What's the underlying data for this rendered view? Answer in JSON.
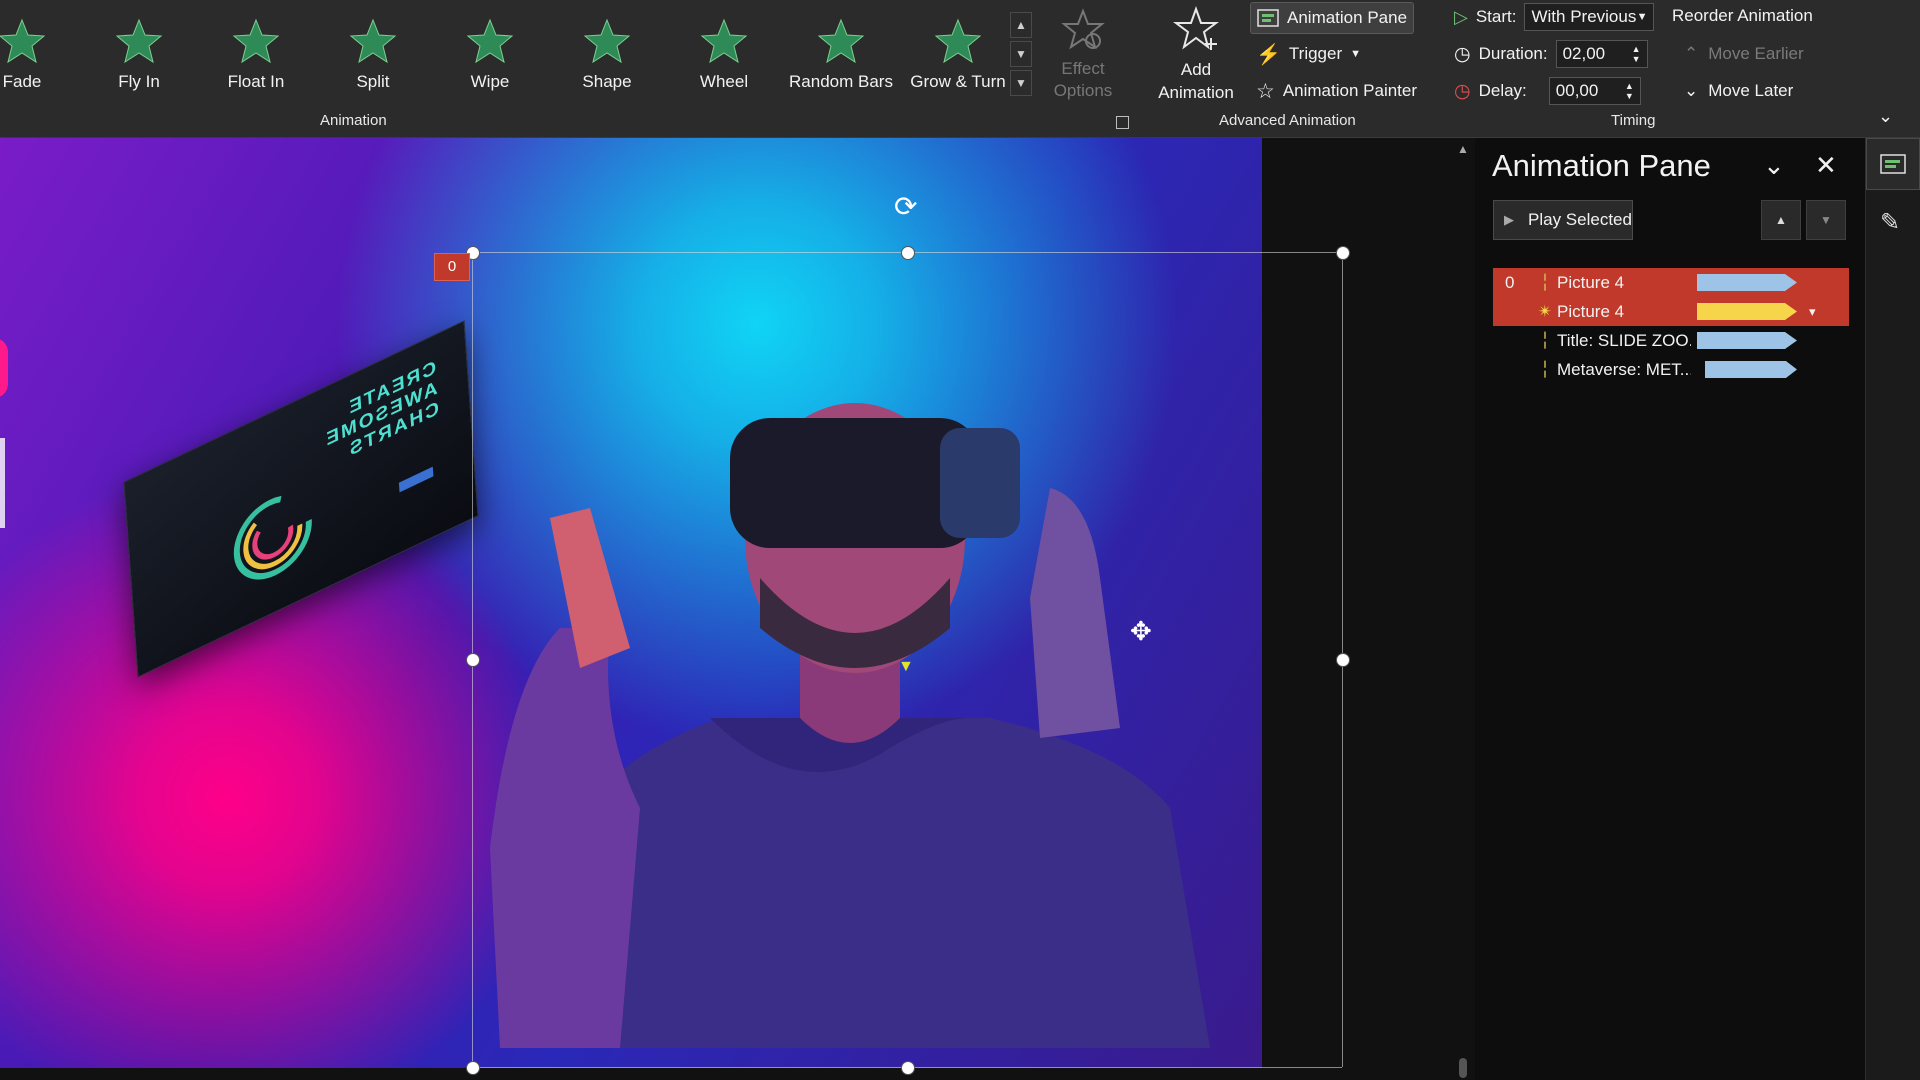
{
  "ribbon": {
    "animations": [
      {
        "label": "Fade",
        "icon": "fade-star-icon"
      },
      {
        "label": "Fly In",
        "icon": "fly-in-star-icon"
      },
      {
        "label": "Float In",
        "icon": "float-in-star-icon"
      },
      {
        "label": "Split",
        "icon": "split-star-icon"
      },
      {
        "label": "Wipe",
        "icon": "wipe-star-icon"
      },
      {
        "label": "Shape",
        "icon": "shape-star-icon"
      },
      {
        "label": "Wheel",
        "icon": "wheel-star-icon"
      },
      {
        "label": "Random Bars",
        "icon": "random-bars-star-icon"
      },
      {
        "label": "Grow & Turn",
        "icon": "grow-turn-star-icon"
      }
    ],
    "animation_group_label": "Animation",
    "effect_options_label": "Effect Options",
    "add_animation_label": "Add Animation",
    "advanced": {
      "animation_pane_label": "Animation Pane",
      "trigger_label": "Trigger",
      "animation_painter_label": "Animation Painter",
      "group_label": "Advanced Animation"
    },
    "timing": {
      "start_label": "Start:",
      "start_value": "With Previous",
      "duration_label": "Duration:",
      "duration_value": "02,00",
      "delay_label": "Delay:",
      "delay_value": "00,00",
      "reorder_label": "Reorder Animation",
      "move_earlier_label": "Move Earlier",
      "move_later_label": "Move Later",
      "group_label": "Timing"
    }
  },
  "slide": {
    "animation_tag": "0",
    "image_text": "CREATE AWESOME CHARTS"
  },
  "pane": {
    "title": "Animation Pane",
    "play_selected_label": "Play Selected",
    "items": [
      {
        "number": "0",
        "name": "Picture 4",
        "icon": "entrance-icon",
        "selected": true,
        "bar_color": "#9dc3e6"
      },
      {
        "number": "",
        "name": "Picture 4",
        "icon": "emphasis-star-icon",
        "selected": true,
        "bar_color": "#f7d54a"
      },
      {
        "number": "",
        "name": "Title: SLIDE ZOO...",
        "icon": "entrance-icon",
        "selected": false,
        "bar_color": "#9dc3e6"
      },
      {
        "number": "",
        "name": "Metaverse: MET...",
        "icon": "entrance-icon",
        "selected": false,
        "bar_color": "#9dc3e6"
      }
    ]
  },
  "colors": {
    "accent_red": "#c0392b",
    "star_green": "#2e8b57",
    "ribbon_bg": "#2b2b2b"
  }
}
